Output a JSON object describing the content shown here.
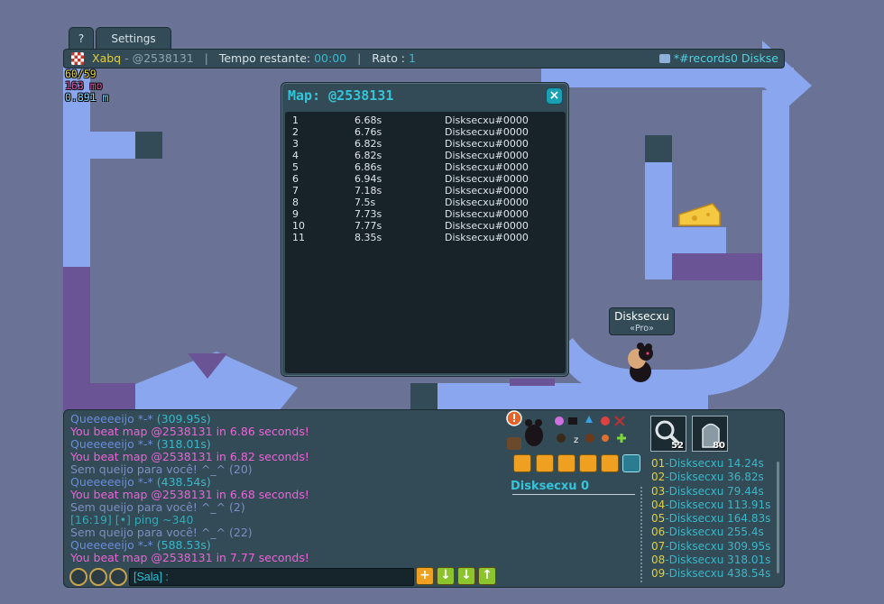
{
  "tabs": {
    "help": "?",
    "settings": "Settings"
  },
  "infobar": {
    "author": "Xabq",
    "separator": "-",
    "map_code": "@2538131",
    "time_label": "Tempo restante:",
    "time_value": "00:00",
    "mice_label": "Rato :",
    "mice_value": "1",
    "room": "*#records0 Diskse"
  },
  "stats": {
    "fps": "60/59",
    "memory": "163 mo",
    "latency": "0.891 m"
  },
  "popup": {
    "title": "Map: @2538131",
    "close_icon": "×",
    "records": [
      {
        "rank": "1",
        "time": "6.68s",
        "name": "Disksecxu#0000"
      },
      {
        "rank": "2",
        "time": "6.76s",
        "name": "Disksecxu#0000"
      },
      {
        "rank": "3",
        "time": "6.82s",
        "name": "Disksecxu#0000"
      },
      {
        "rank": "4",
        "time": "6.82s",
        "name": "Disksecxu#0000"
      },
      {
        "rank": "5",
        "time": "6.86s",
        "name": "Disksecxu#0000"
      },
      {
        "rank": "6",
        "time": "6.94s",
        "name": "Disksecxu#0000"
      },
      {
        "rank": "7",
        "time": "7.18s",
        "name": "Disksecxu#0000"
      },
      {
        "rank": "8",
        "time": "7.5s",
        "name": "Disksecxu#0000"
      },
      {
        "rank": "9",
        "time": "7.73s",
        "name": "Disksecxu#0000"
      },
      {
        "rank": "10",
        "time": "7.77s",
        "name": "Disksecxu#0000"
      },
      {
        "rank": "11",
        "time": "8.35s",
        "name": "Disksecxu#0000"
      }
    ]
  },
  "player": {
    "name": "Disksecxu",
    "title": "«Pro»"
  },
  "chat": {
    "lines": [
      {
        "text": "Queeeeeijo *-* ",
        "extra": "(309.95s)",
        "style": "c-blue"
      },
      {
        "text": "You beat map @2538131 in 6.86 seconds!",
        "extra": "",
        "style": "c-pink"
      },
      {
        "text": "Queeeeeijo *-* ",
        "extra": "(318.01s)",
        "style": "c-blue"
      },
      {
        "text": "You beat map @2538131 in 6.82 seconds!",
        "extra": "",
        "style": "c-pink"
      },
      {
        "text": "Sem queijo para você! ^_^ (20)",
        "extra": "",
        "style": "c-grey"
      },
      {
        "text": "Queeeeeijo *-* ",
        "extra": "(438.54s)",
        "style": "c-blue"
      },
      {
        "text": "You beat map @2538131 in 6.68 seconds!",
        "extra": "",
        "style": "c-pink"
      },
      {
        "text": "Sem queijo para você! ^_^ (2)",
        "extra": "",
        "style": "c-grey"
      },
      {
        "text": "[16:19] [•] ping ~340",
        "extra": "",
        "style": "c-teal"
      },
      {
        "text": "Sem queijo para você! ^_^ (22)",
        "extra": "",
        "style": "c-grey"
      },
      {
        "text": "Queeeeeijo *-* ",
        "extra": "(588.53s)",
        "style": "c-blue"
      },
      {
        "text": "You beat map @2538131 in 7.77 seconds!",
        "extra": "",
        "style": "c-pink"
      }
    ],
    "input_placeholder": "[Sala] :"
  },
  "panel": {
    "player_score": "Disksecxu 0",
    "items": [
      {
        "count": "52",
        "icon": "magnifier-icon"
      },
      {
        "count": "80",
        "icon": "tombstone-icon"
      }
    ],
    "ranking": [
      {
        "num": "01",
        "name": "-Disksecxu",
        "time": "14.24s"
      },
      {
        "num": "02",
        "name": "-Disksecxu",
        "time": "36.82s"
      },
      {
        "num": "03",
        "name": "-Disksecxu",
        "time": "79.44s"
      },
      {
        "num": "04",
        "name": "-Disksecxu",
        "time": "113.91s"
      },
      {
        "num": "05",
        "name": "-Disksecxu",
        "time": "164.83s"
      },
      {
        "num": "06",
        "name": "-Disksecxu",
        "time": "255.4s"
      },
      {
        "num": "07",
        "name": "-Disksecxu",
        "time": "309.95s"
      },
      {
        "num": "08",
        "name": "-Disksecxu",
        "time": "318.01s"
      },
      {
        "num": "09",
        "name": "-Disksecxu",
        "time": "438.54s"
      }
    ]
  },
  "colors": {
    "ground": "#8aa6ee",
    "lava": "#6b5496",
    "dark_block": "#324b56",
    "sky": "#6a7296"
  }
}
